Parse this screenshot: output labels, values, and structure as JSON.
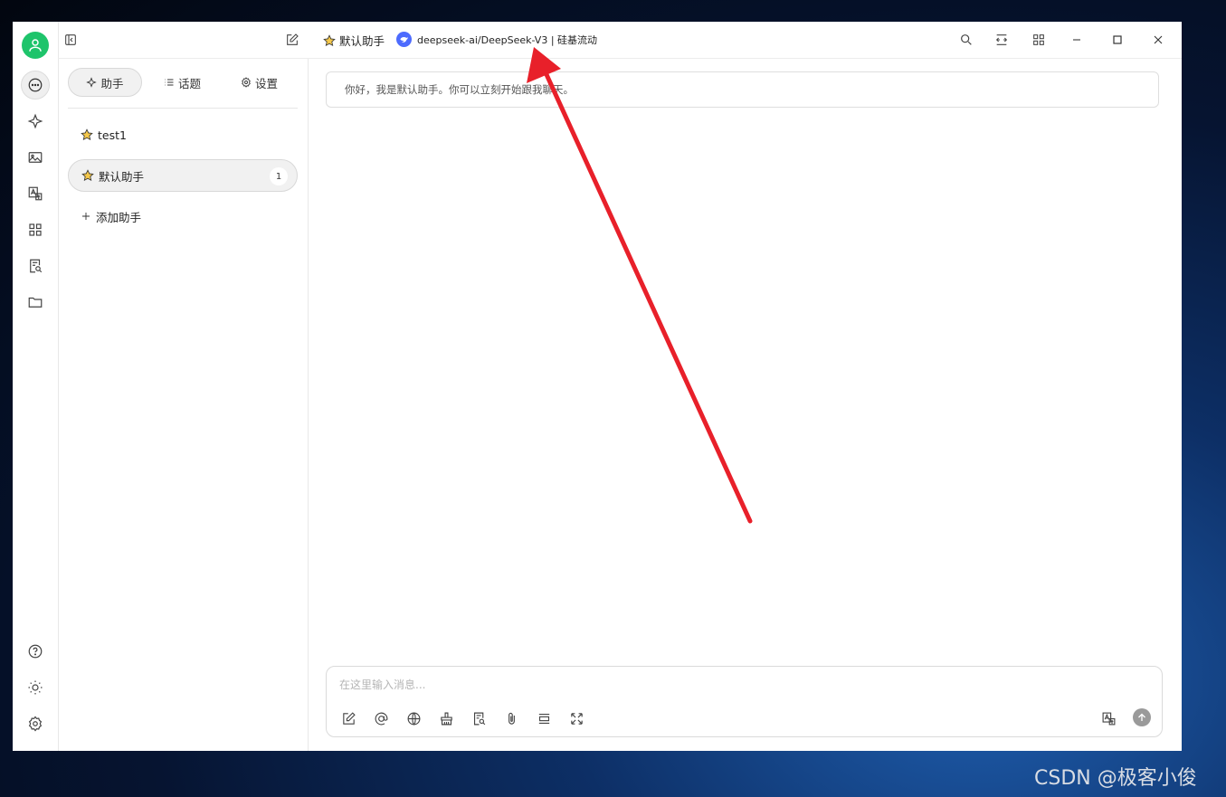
{
  "topbar": {
    "assistant_name": "默认助手",
    "model_label": "deepseek-ai/DeepSeek-V3 | 硅基流动"
  },
  "panel": {
    "tabs": [
      {
        "label": "助手"
      },
      {
        "label": "话题"
      },
      {
        "label": "设置"
      }
    ],
    "assistants": [
      {
        "name": "test1"
      },
      {
        "name": "默认助手",
        "count": "1"
      }
    ],
    "add_label": "添加助手"
  },
  "main": {
    "greeting": "你好，我是默认助手。你可以立刻开始跟我聊天。",
    "input_placeholder": "在这里输入消息..."
  },
  "watermark": "CSDN @极客小俊",
  "colors": {
    "accent_green": "#1ec46b",
    "model_logo_blue": "#4d6bfe",
    "annotation_arrow": "#e8202a"
  }
}
